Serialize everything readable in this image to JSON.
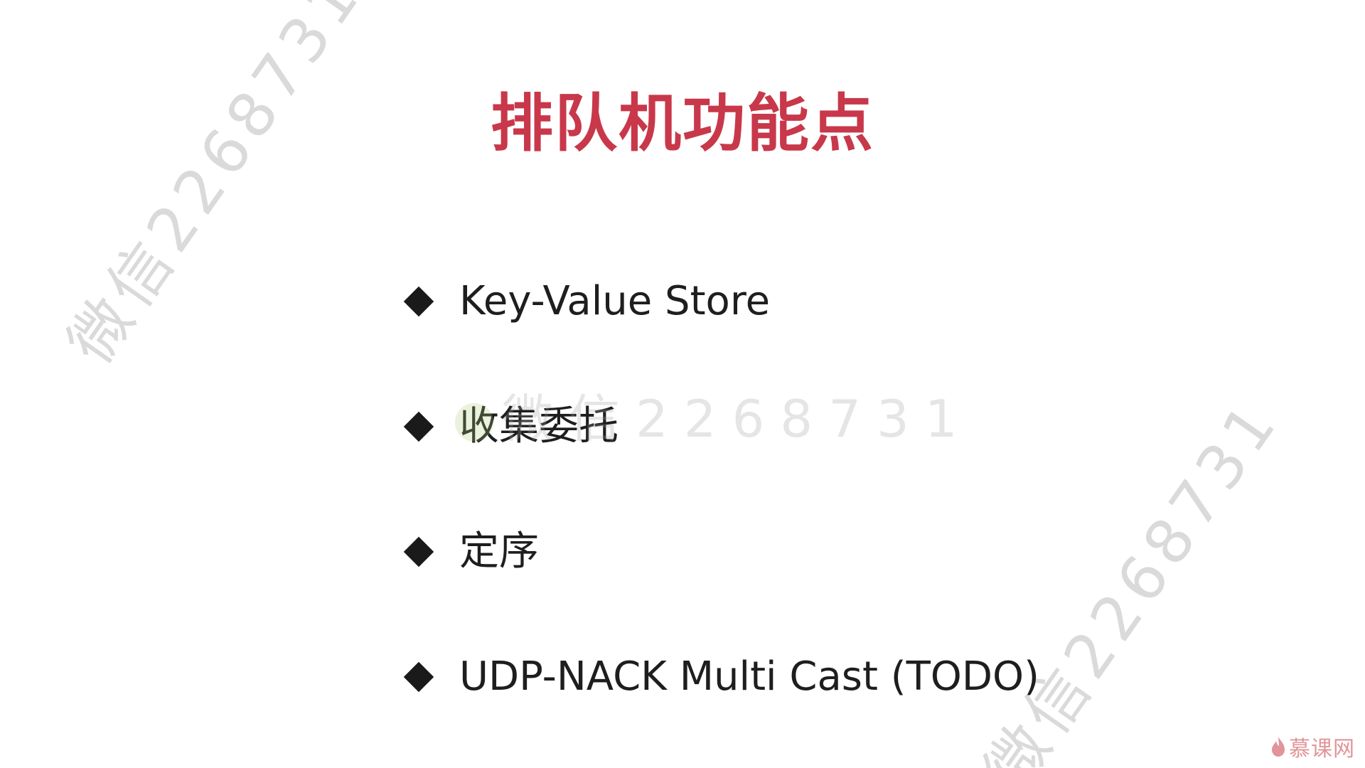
{
  "slide": {
    "title": "排队机功能点",
    "bullets": [
      {
        "label": "Key-Value Store"
      },
      {
        "label": "收集委托"
      },
      {
        "label": "定序"
      },
      {
        "label": "UDP-NACK Multi Cast (TODO)"
      }
    ]
  },
  "watermarks": {
    "diagonal_top": "微信2268731",
    "center": "微信2268731",
    "diagonal_bottom": "微信2268731"
  },
  "logo": {
    "text": "慕课网",
    "icon": "flame-icon"
  },
  "colors": {
    "title": "#c8384a",
    "bullet_text": "#1e1e1e",
    "bullet_marker": "#1a1a1a",
    "background": "#ffffff"
  }
}
